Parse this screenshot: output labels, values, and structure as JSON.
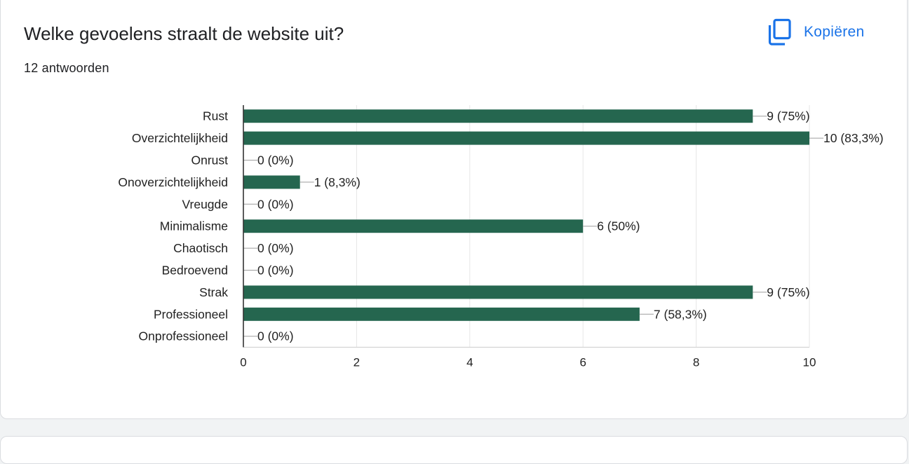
{
  "question": {
    "title": "Welke gevoelens straalt de website uit?",
    "responses": "12 antwoorden",
    "copy_label": "Kopiëren"
  },
  "colors": {
    "bar": "#25664f",
    "accent": "#1a73e8"
  },
  "chart_data": {
    "type": "bar",
    "orientation": "horizontal",
    "categories": [
      "Rust",
      "Overzichtelijkheid",
      "Onrust",
      "Onoverzichtelijkheid",
      "Vreugde",
      "Minimalisme",
      "Chaotisch",
      "Bedroevend",
      "Strak",
      "Professioneel",
      "Onprofessioneel"
    ],
    "values": [
      9,
      10,
      0,
      1,
      0,
      6,
      0,
      0,
      9,
      7,
      0
    ],
    "data_labels": [
      "9 (75%)",
      "10 (83,3%)",
      "0 (0%)",
      "1 (8,3%)",
      "0 (0%)",
      "6 (50%)",
      "0 (0%)",
      "0 (0%)",
      "9 (75%)",
      "7 (58,3%)",
      "0 (0%)"
    ],
    "xlim": [
      0,
      10
    ],
    "xticks": [
      "0",
      "2",
      "4",
      "6",
      "8",
      "10"
    ],
    "grid": true,
    "xlabel": "",
    "ylabel": "",
    "title": ""
  }
}
